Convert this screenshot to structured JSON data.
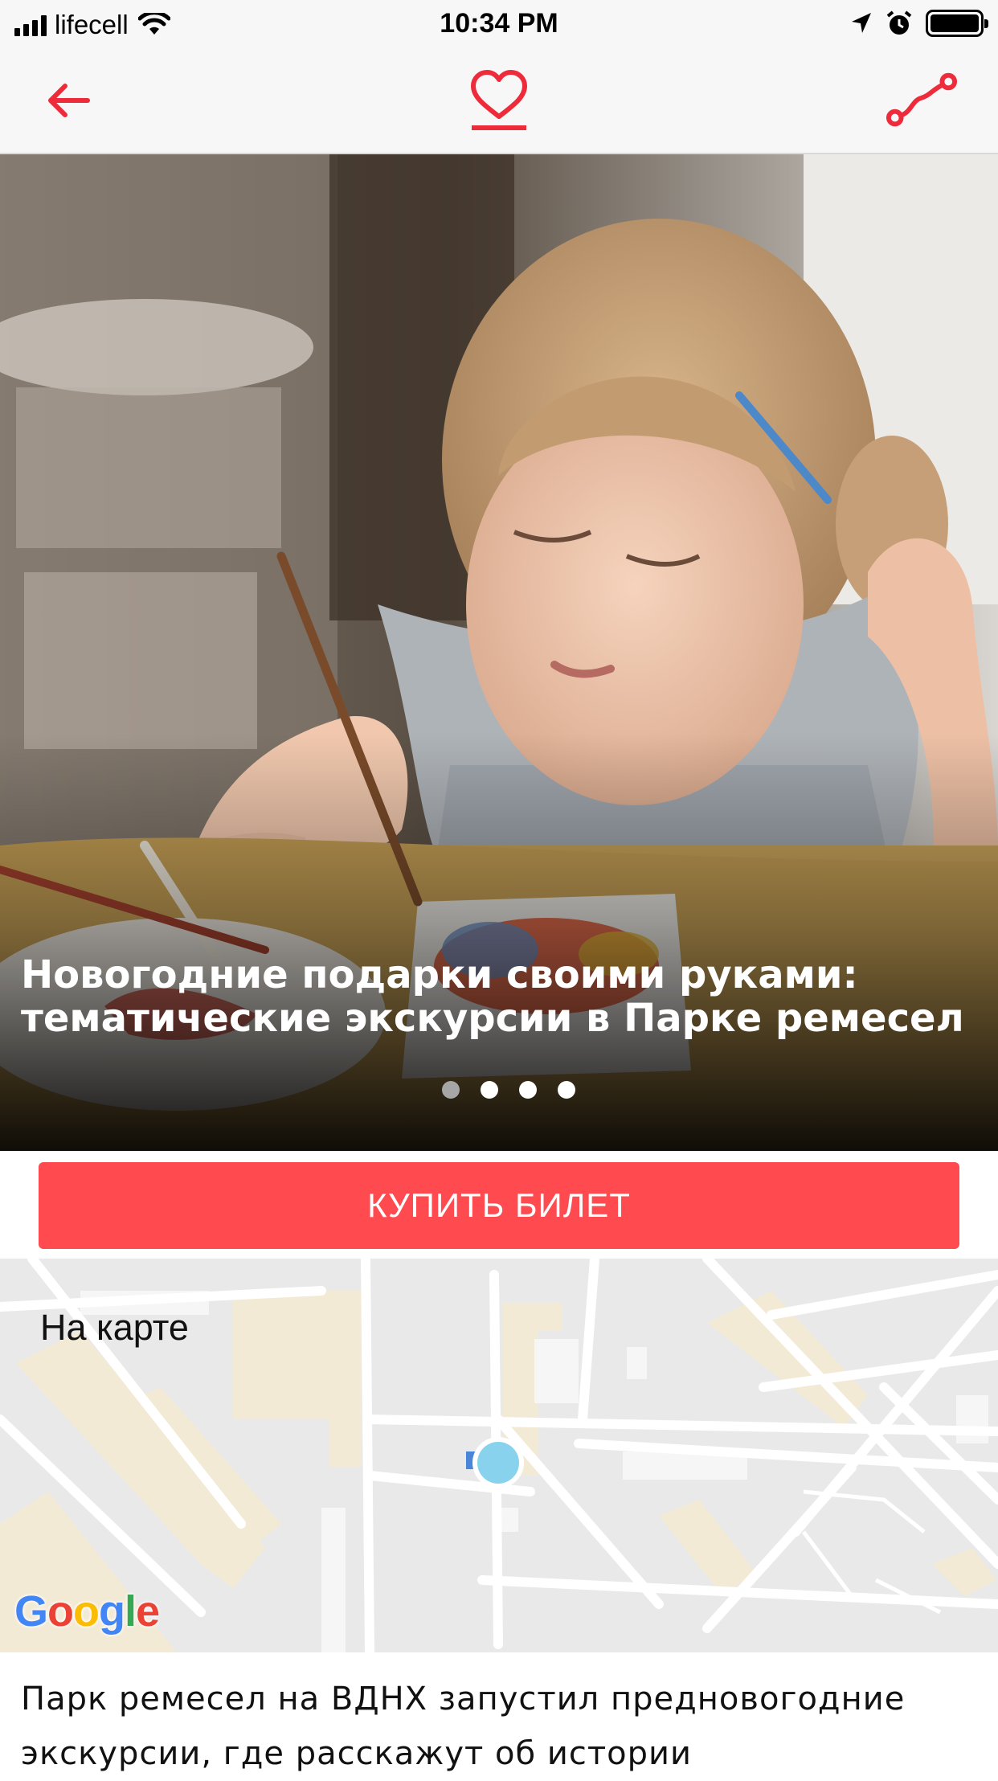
{
  "status_bar": {
    "carrier": "lifecell",
    "time": "10:34 PM"
  },
  "nav": {
    "back_icon": "arrow-left-icon",
    "favorite_icon": "heart-icon",
    "route_icon": "route-icon",
    "accent_color": "#ee2b3b"
  },
  "hero": {
    "title": "Новогодние подарки своими руками: тематические экскурсии в Парке ремесел",
    "slides_total": 4,
    "active_slide": 1
  },
  "buy_button": {
    "label": "КУПИТЬ БИЛЕТ",
    "color": "#ff4a4f"
  },
  "map": {
    "label": "На карте",
    "provider_logo": "Google",
    "marker_color": "#88d2ee"
  },
  "article": {
    "text": "Парк ремесел на ВДНХ запустил предновогодние экскурсии, где расскажут об истории"
  }
}
